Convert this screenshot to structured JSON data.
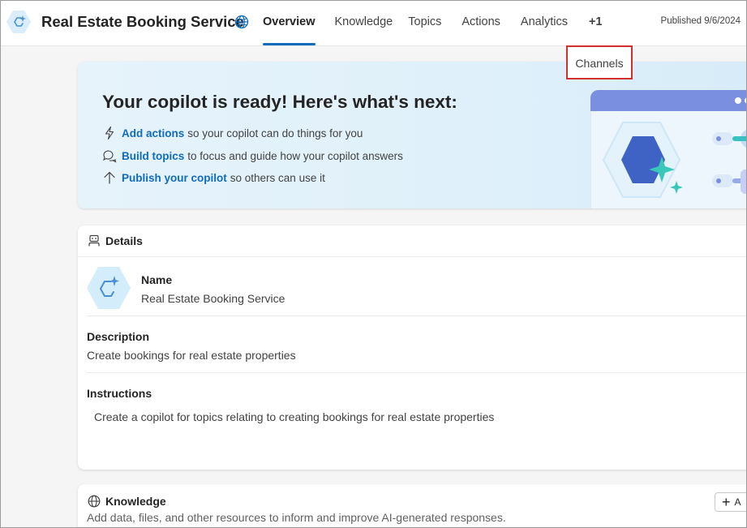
{
  "header": {
    "app_title": "Real Estate Booking Service",
    "tabs": [
      {
        "label": "Overview",
        "active": true
      },
      {
        "label": "Knowledge"
      },
      {
        "label": "Topics"
      },
      {
        "label": "Actions"
      },
      {
        "label": "Analytics"
      },
      {
        "label": "+1"
      }
    ],
    "published": "Published 9/6/2024"
  },
  "overflow_menu": {
    "channels": "Channels"
  },
  "hero": {
    "title": "Your copilot is ready! Here's what's next:",
    "items": [
      {
        "link": "Add actions",
        "text": "so your copilot can do things for you",
        "icon": "lightning-icon"
      },
      {
        "link": "Build topics",
        "text": "to focus and guide how your copilot answers",
        "icon": "chat-bubbles-icon"
      },
      {
        "link": "Publish your copilot",
        "text": "so others can use it",
        "icon": "arrow-up-icon"
      }
    ]
  },
  "details": {
    "heading": "Details",
    "name_label": "Name",
    "name_value": "Real Estate Booking Service",
    "description_label": "Description",
    "description_value": "Create bookings for real estate properties",
    "instructions_label": "Instructions",
    "instructions_value": "Create a copilot for topics relating to creating bookings for real estate properties"
  },
  "knowledge": {
    "heading": "Knowledge",
    "description": "Add data, files, and other resources to inform and improve AI-generated responses.",
    "add_label": "A"
  },
  "colors": {
    "accent": "#0f6cbd",
    "highlight_border": "#d32f2f",
    "hero_background": "#e2f1fa"
  }
}
